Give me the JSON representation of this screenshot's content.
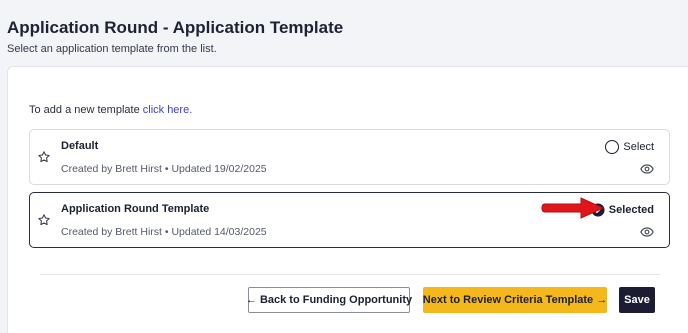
{
  "header": {
    "title": "Application Round - Application Template",
    "subtitle": "Select an application template from the list."
  },
  "add_hint": {
    "prefix": "To add a new template ",
    "link": "click here."
  },
  "templates": [
    {
      "name": "Default",
      "meta": "Created by Brett Hirst • Updated 19/02/2025",
      "select_label": "Select",
      "selected": false,
      "icon": "radio-empty-icon"
    },
    {
      "name": "Application Round Template",
      "meta": "Created by Brett Hirst • Updated 14/03/2025",
      "select_label": "Selected",
      "selected": true,
      "icon": "check-circle-icon"
    }
  ],
  "footer": {
    "back_label": "← Back to Funding Opportunity",
    "next_label": "Next to Review Criteria Template →",
    "save_label": "Save"
  },
  "colors": {
    "accent_link": "#3d3fd6",
    "next_button": "#f5b81c",
    "save_button": "#1c1d33",
    "annotation_arrow": "#e0161b"
  }
}
